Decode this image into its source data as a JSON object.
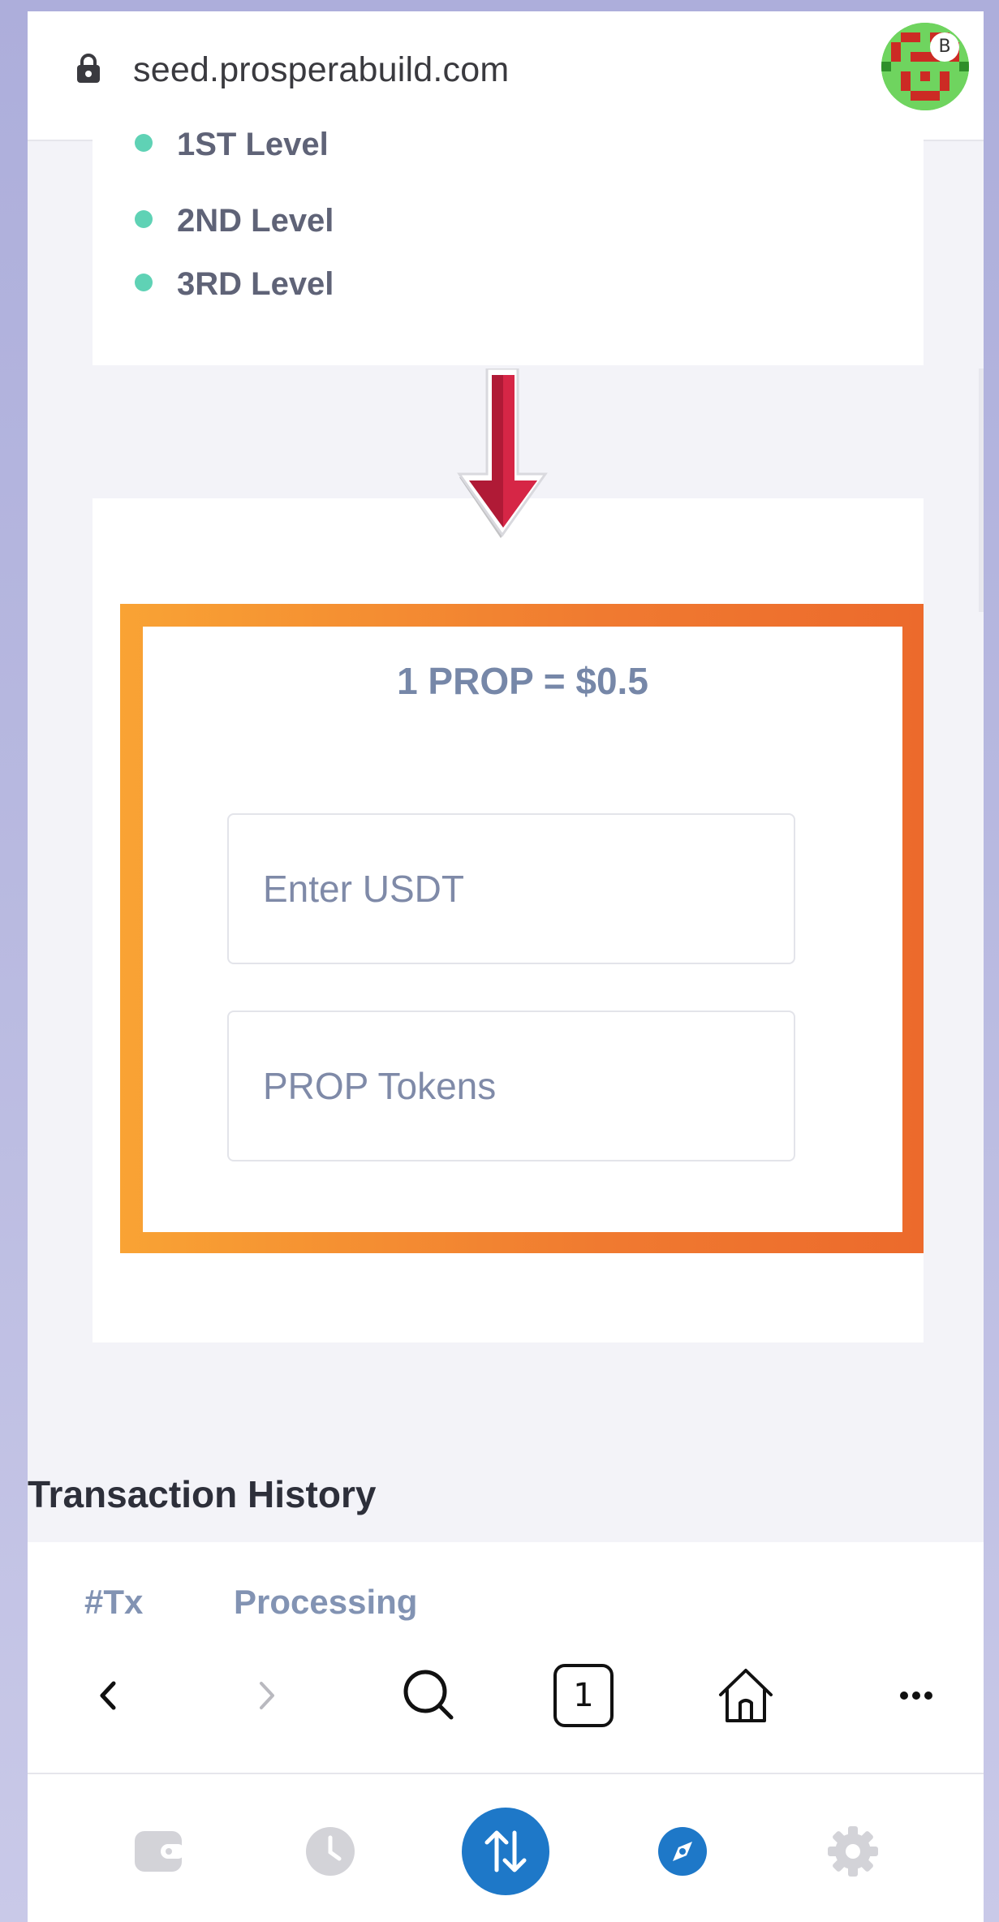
{
  "address_bar": {
    "url": "seed.prosperabuild.com",
    "avatar_badge": "B"
  },
  "levels": {
    "items": [
      {
        "label": "1ST Level"
      },
      {
        "label": "2ND Level"
      },
      {
        "label": "3RD Level"
      }
    ]
  },
  "buy": {
    "price": "1 PROP = $0.5",
    "usdt_placeholder": "Enter USDT",
    "prop_placeholder": "PROP Tokens"
  },
  "transactions": {
    "title": "Transaction History",
    "columns": [
      "#Tx",
      "Processing"
    ]
  },
  "toolbar": {
    "back_icon": "chevron-left-icon",
    "forward_icon": "chevron-right-icon",
    "search_icon": "search-icon",
    "tabs_count": "1",
    "home_icon": "home-icon",
    "more_icon": "more-icon"
  },
  "bottom_nav": {
    "items": [
      "wallet-icon",
      "history-icon",
      "swap-icon",
      "browser-compass-icon",
      "settings-icon"
    ]
  },
  "colors": {
    "accent_blue": "#1e78c8",
    "arrow_red": "#b01a36",
    "frame_orange_start": "#f9a334",
    "frame_orange_end": "#ec6a2c",
    "level_dot": "#5fd2b5"
  }
}
